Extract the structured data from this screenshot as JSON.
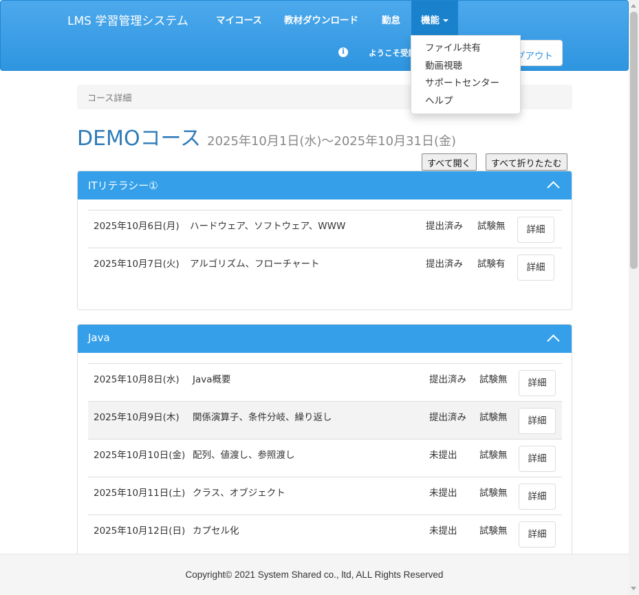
{
  "navbar": {
    "brand": "LMS 学習管理システム",
    "items": [
      "マイコース",
      "教材ダウンロード",
      "勤怠"
    ],
    "active_item": "機能",
    "info_icon": "i",
    "welcome": "ようこそ受講生",
    "logout": "ログアウト"
  },
  "dropdown": {
    "items": [
      "ファイル共有",
      "動画視聴",
      "サポートセンター",
      "ヘルプ"
    ]
  },
  "breadcrumb": "コース詳細",
  "title": {
    "main": "DEMOコース",
    "period": "2025年10月1日(水)～2025年10月31日(金)"
  },
  "buttons": {
    "expand_all": "すべて開く",
    "collapse_all": "すべて折りたたむ"
  },
  "sections": [
    {
      "title": "ITリテラシー①",
      "rows": [
        {
          "date": "2025年10月6日(月)",
          "topic": "ハードウェア、ソフトウェア、WWW",
          "status": "提出済み",
          "exam": "試験無",
          "action": "詳細"
        },
        {
          "date": "2025年10月7日(火)",
          "topic": "アルゴリズム、フローチャート",
          "status": "提出済み",
          "exam": "試験有",
          "action": "詳細"
        }
      ]
    },
    {
      "title": "Java",
      "rows": [
        {
          "date": "2025年10月8日(水)",
          "topic": "Java概要",
          "status": "提出済み",
          "exam": "試験無",
          "action": "詳細"
        },
        {
          "date": "2025年10月9日(木)",
          "topic": "関係演算子、条件分岐、繰り返し",
          "status": "提出済み",
          "exam": "試験無",
          "action": "詳細"
        },
        {
          "date": "2025年10月10日(金)",
          "topic": "配列、値渡し、参照渡し",
          "status": "未提出",
          "exam": "試験無",
          "action": "詳細"
        },
        {
          "date": "2025年10月11日(土)",
          "topic": "クラス、オブジェクト",
          "status": "未提出",
          "exam": "試験無",
          "action": "詳細"
        },
        {
          "date": "2025年10月12日(日)",
          "topic": "カプセル化",
          "status": "未提出",
          "exam": "試験無",
          "action": "詳細"
        }
      ]
    }
  ],
  "footer": "Copyright© 2021 System Shared co., ltd, ALL Rights Reserved",
  "colors": {
    "navbar": "#35a0e9",
    "panel_heading": "#35a0e9",
    "title": "#2d7bb8"
  }
}
